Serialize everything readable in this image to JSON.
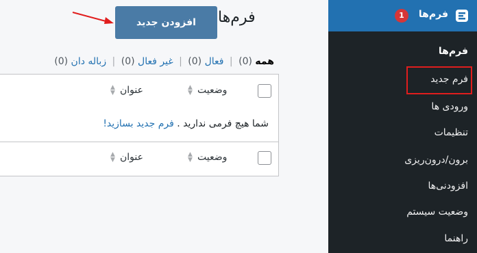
{
  "page": {
    "title": "فرم‌ها",
    "add_button": "افزودن جدید"
  },
  "filters": {
    "all": "همه",
    "all_count": "(0)",
    "active": "فعال",
    "active_count": "(0)",
    "inactive": "غیر فعال",
    "inactive_count": "(0)",
    "trash": "زباله دان",
    "trash_count": "(0)"
  },
  "table": {
    "col_status": "وضعیت",
    "col_title": "عنوان",
    "empty_text": "شما هیچ فرمی ندارید . ",
    "empty_link": "فرم جدید بسازید!"
  },
  "sidebar": {
    "menu_label": "فرم‌ها",
    "badge": "1",
    "items": [
      {
        "label": "فرم‌ها"
      },
      {
        "label": "فرم جدید"
      },
      {
        "label": "ورودی ها"
      },
      {
        "label": "تنظیمات"
      },
      {
        "label": "برون/درون‌ریزی"
      },
      {
        "label": "افزودنی‌ها"
      },
      {
        "label": "وضعیت سیستم"
      },
      {
        "label": "راهنما"
      }
    ]
  },
  "colors": {
    "accent": "#2271b1",
    "sidebar_bg": "#1d2327",
    "button_bg": "#4a7ba6",
    "highlight": "#e11d1d",
    "badge": "#d63638"
  },
  "icons": [
    "form-plugin-icon",
    "sort-arrows-icon",
    "annotation-arrow"
  ]
}
